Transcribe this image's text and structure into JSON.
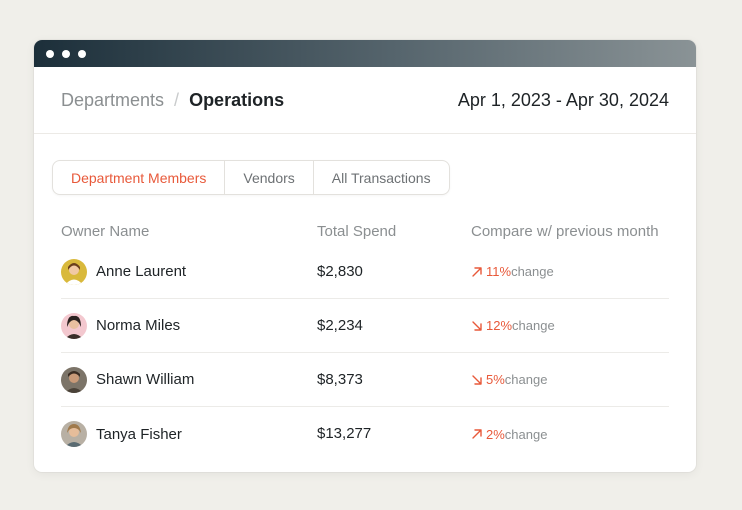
{
  "breadcrumb": {
    "parent": "Departments",
    "separator": "/",
    "current": "Operations"
  },
  "date_range": "Apr 1, 2023 - Apr 30, 2024",
  "tabs": [
    {
      "label": "Department Members",
      "active": true
    },
    {
      "label": "Vendors",
      "active": false
    },
    {
      "label": "All Transactions",
      "active": false
    }
  ],
  "table": {
    "headers": {
      "owner": "Owner Name",
      "spend": "Total Spend",
      "compare": "Compare w/ previous month"
    },
    "rows": [
      {
        "name": "Anne Laurent",
        "spend": "$2,830",
        "direction": "up",
        "pct": "11%",
        "change": "change"
      },
      {
        "name": "Norma Miles",
        "spend": "$2,234",
        "direction": "down",
        "pct": "12%",
        "change": "change"
      },
      {
        "name": "Shawn William",
        "spend": "$8,373",
        "direction": "down",
        "pct": "5%",
        "change": "change"
      },
      {
        "name": "Tanya Fisher",
        "spend": "$13,277",
        "direction": "up",
        "pct": "2%",
        "change": "change"
      }
    ]
  },
  "colors": {
    "accent": "#e8593a",
    "muted": "#8b8f91",
    "text": "#1e2326"
  }
}
